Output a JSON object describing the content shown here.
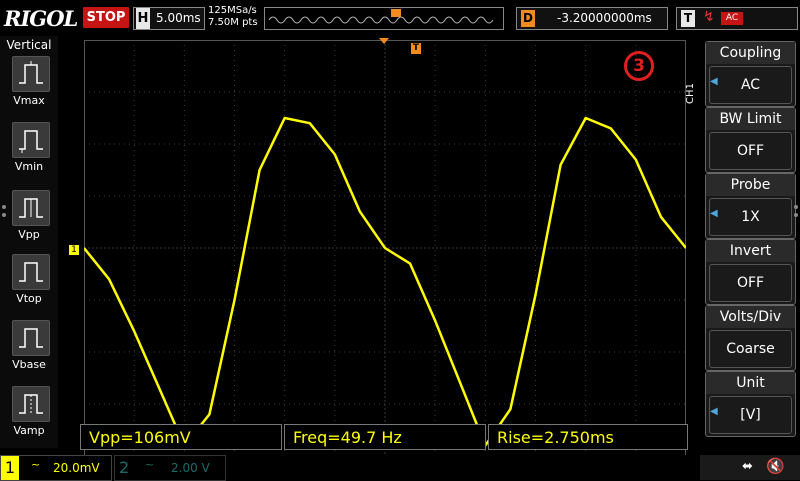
{
  "brand": "RIGOL",
  "run_state": "STOP",
  "horizontal": {
    "key": "H",
    "timebase": "5.00ms",
    "sample_rate": "125MSa/s",
    "memory_depth": "7.50M pts"
  },
  "trigger_marker": "T",
  "delay": {
    "key": "D",
    "value": "-3.20000000ms"
  },
  "trigger": {
    "key": "T",
    "slope_icon": "rising-edge-icon",
    "source": "AC"
  },
  "left_panel": {
    "title": "Vertical",
    "items": [
      {
        "label": "Vmax",
        "icon": "vmax-icon"
      },
      {
        "label": "Vmin",
        "icon": "vmin-icon"
      },
      {
        "label": "Vpp",
        "icon": "vpp-icon"
      },
      {
        "label": "Vtop",
        "icon": "vtop-icon"
      },
      {
        "label": "Vbase",
        "icon": "vbase-icon"
      },
      {
        "label": "Vamp",
        "icon": "vamp-icon"
      }
    ]
  },
  "channel_tab": "CH1",
  "step_marker": "3",
  "channel_ref": "1",
  "right_menu": [
    {
      "title": "Coupling",
      "value": "AC",
      "has_arrow": true
    },
    {
      "title": "BW Limit",
      "value": "OFF",
      "has_arrow": false
    },
    {
      "title": "Probe",
      "value": "1X",
      "has_arrow": true
    },
    {
      "title": "Invert",
      "value": "OFF",
      "has_arrow": false
    },
    {
      "title": "Volts/Div",
      "value": "Coarse",
      "has_arrow": false
    },
    {
      "title": "Unit",
      "value": "[V]",
      "has_arrow": true
    }
  ],
  "measurements": {
    "vpp": "Vpp=106mV",
    "freq": "Freq=49.7 Hz",
    "rise": "Rise=2.750ms"
  },
  "channels": [
    {
      "number": "1",
      "coupling_symbol": "~",
      "scale": "20.0mV"
    },
    {
      "number": "2",
      "coupling_symbol": "~",
      "scale": "2.00 V"
    }
  ],
  "colors": {
    "trace": "#ffff00",
    "grid": "#3a3a3a",
    "stop": "#c41414",
    "trigger_marker": "#f58a1f",
    "menu_arrow": "#4ea6dc"
  },
  "chart_data": {
    "type": "line",
    "title": "",
    "xlabel": "",
    "ylabel": "",
    "x_divisions": 12,
    "y_divisions": 8,
    "series": [
      {
        "name": "",
        "x": [
          0,
          0.5,
          1,
          1.5,
          2,
          2.5,
          3,
          3.5,
          4,
          4.5,
          5,
          5.5,
          6,
          6.5,
          7,
          7.5,
          8,
          8.5,
          9,
          9.5,
          10,
          10.5,
          11,
          11.5,
          12
        ],
        "y": [
          0,
          -0.6,
          -1.6,
          -2.7,
          -3.8,
          -3.2,
          -1.0,
          1.5,
          2.5,
          2.4,
          1.8,
          0.7,
          0.0,
          -0.3,
          -1.4,
          -2.6,
          -3.8,
          -3.1,
          -0.9,
          1.6,
          2.5,
          2.3,
          1.7,
          0.6,
          0.0
        ]
      }
    ],
    "grid": true
  }
}
